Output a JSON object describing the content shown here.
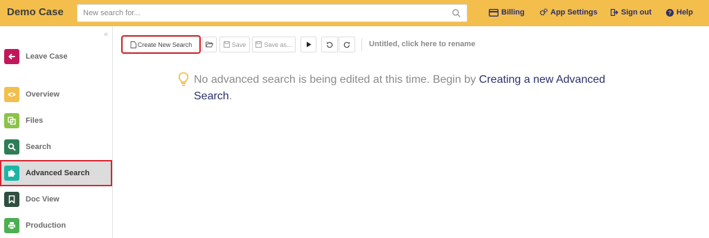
{
  "app": {
    "brand": "Demo Case"
  },
  "search": {
    "placeholder": "New search for..."
  },
  "topnav": {
    "billing": "Billing",
    "app_settings": "App Settings",
    "sign_out": "Sign out",
    "help": "Help"
  },
  "sidebar": {
    "collapse_glyph": "«",
    "items": [
      {
        "label": "Leave Case",
        "icon": "arrow-left-icon",
        "color": "#c2185b"
      },
      {
        "label": "Overview",
        "icon": "eye-icon",
        "color": "#f3be4c"
      },
      {
        "label": "Files",
        "icon": "files-icon",
        "color": "#8bc34a"
      },
      {
        "label": "Search",
        "icon": "search-icon",
        "color": "#2e7d57"
      },
      {
        "label": "Advanced Search",
        "icon": "puzzle-icon",
        "color": "#1fb5a6",
        "active": true
      },
      {
        "label": "Doc View",
        "icon": "bookmark-icon",
        "color": "#2f4f3f"
      },
      {
        "label": "Production",
        "icon": "print-icon",
        "color": "#4caf50"
      }
    ]
  },
  "toolbar": {
    "create_new": "Create New Search",
    "save": "Save",
    "save_as": "Save as...",
    "rename_hint": "Untitled, click here to rename"
  },
  "empty_state": {
    "text_before": "No advanced search is being edited at this time. Begin by ",
    "link": "Creating a new Advanced Search",
    "text_after": "."
  },
  "colors": {
    "topbar": "#f3be4c",
    "nav_text": "#2b2f6b",
    "highlight": "#d9242f"
  }
}
